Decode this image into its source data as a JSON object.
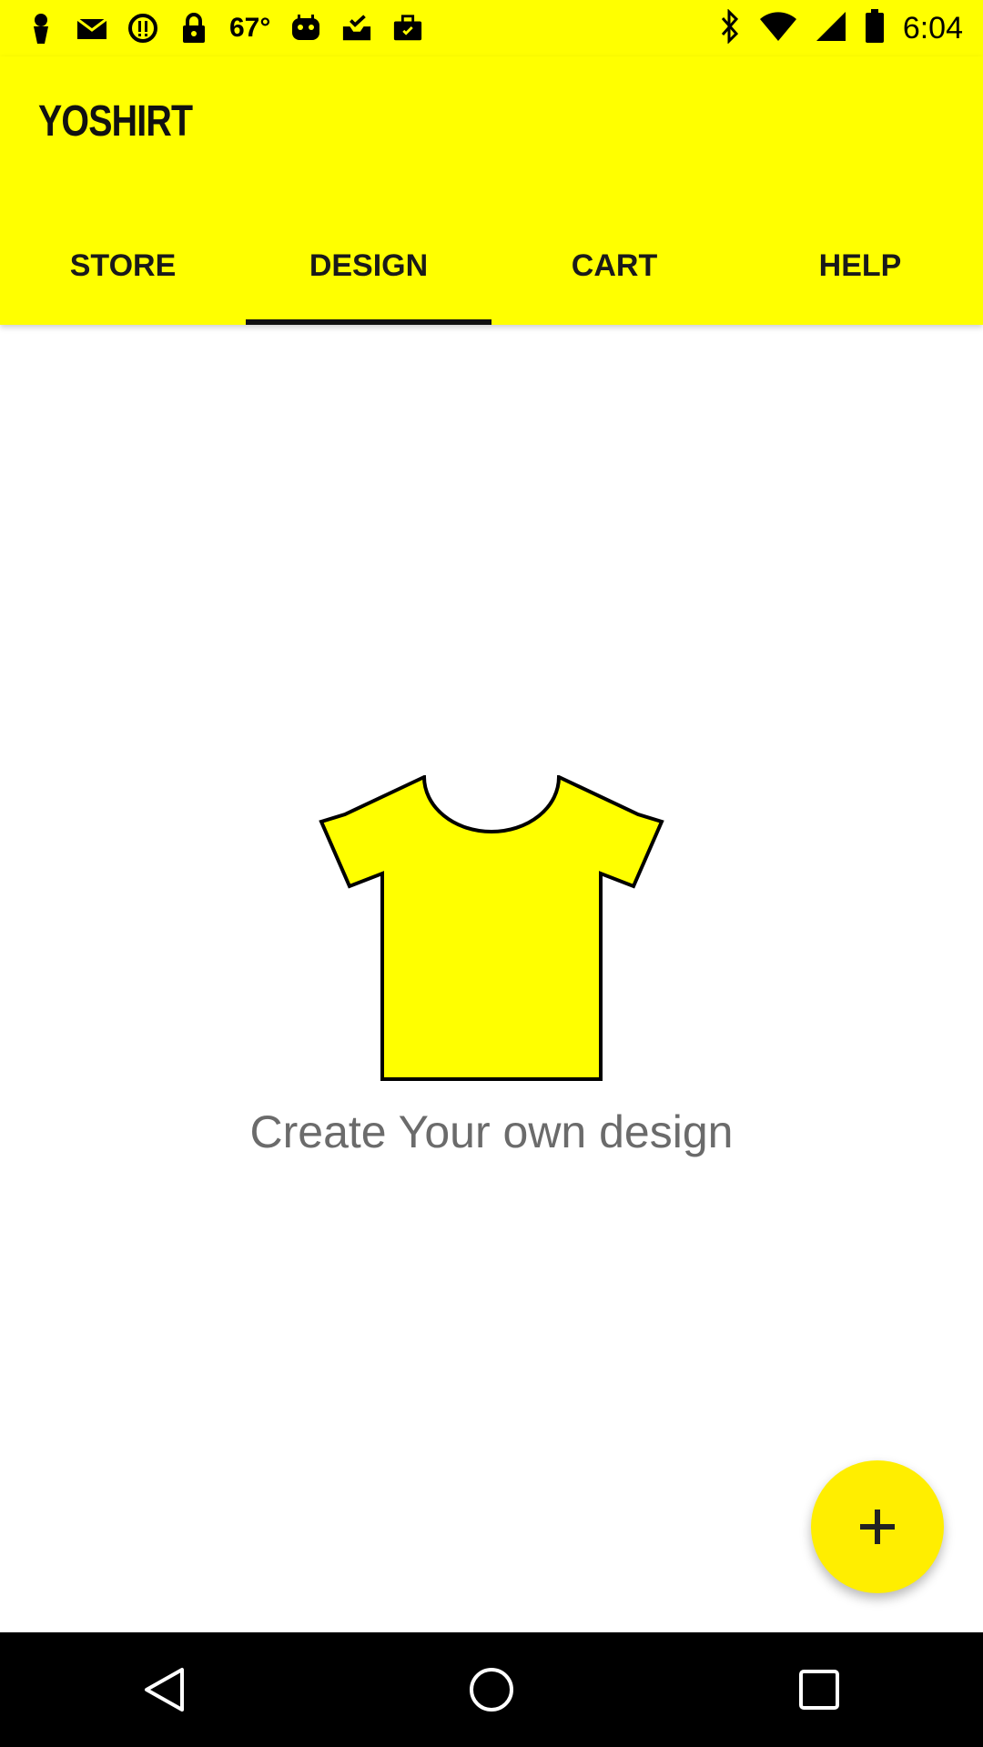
{
  "status_bar": {
    "temperature": "67°",
    "time": "6:04",
    "icons_left": [
      "person-pin-icon",
      "mail-icon",
      "alert-icon",
      "lock-icon",
      "temperature-text",
      "android-icon",
      "inbox-check-icon",
      "briefcase-icon"
    ],
    "icons_right": [
      "bluetooth-icon",
      "wifi-icon",
      "signal-icon",
      "battery-icon"
    ]
  },
  "app_bar": {
    "title": "YOSHIRT",
    "tabs": [
      {
        "label": "STORE",
        "active": false
      },
      {
        "label": "DESIGN",
        "active": true
      },
      {
        "label": "CART",
        "active": false
      },
      {
        "label": "HELP",
        "active": false
      }
    ]
  },
  "main": {
    "empty_state_icon": "tshirt-icon",
    "empty_state_text": "Create Your own design"
  },
  "fab": {
    "icon": "plus-icon"
  },
  "nav_bar": {
    "buttons": [
      "back-icon",
      "home-icon",
      "recents-icon"
    ]
  },
  "colors": {
    "accent": "#ffff00",
    "fab": "#ffee00",
    "text_dark": "#111111",
    "empty_text": "#6b6b6b"
  }
}
